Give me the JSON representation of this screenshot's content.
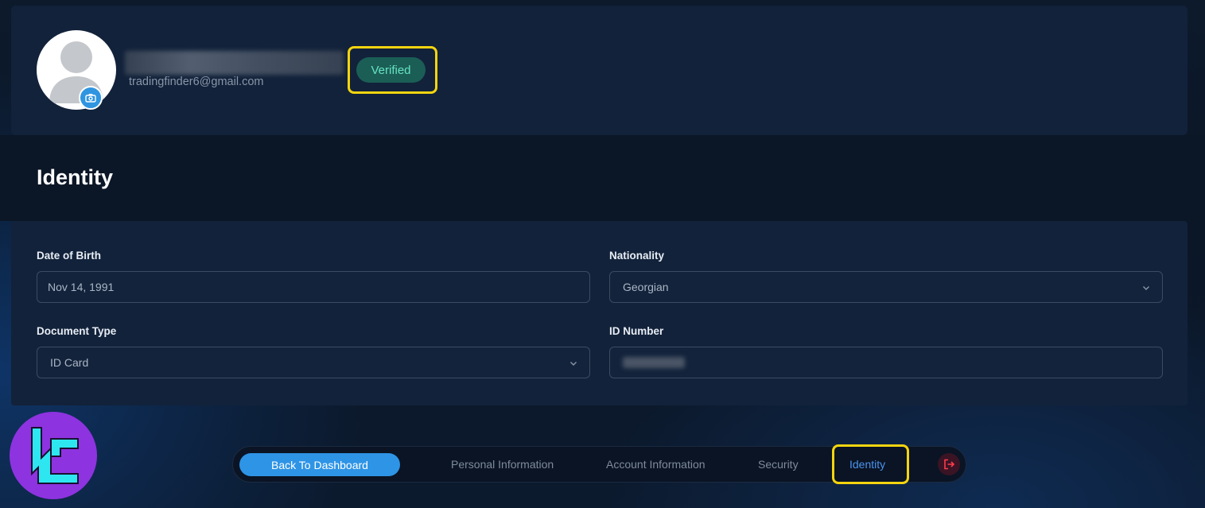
{
  "profile": {
    "email": "tradingfinder6@gmail.com",
    "status_badge": "Verified"
  },
  "section": {
    "title": "Identity"
  },
  "form": {
    "date_of_birth": {
      "label": "Date of Birth",
      "value": "Nov 14, 1991"
    },
    "nationality": {
      "label": "Nationality",
      "value": "Georgian"
    },
    "document_type": {
      "label": "Document Type",
      "value": "ID Card"
    },
    "id_number": {
      "label": "ID Number",
      "value": ""
    }
  },
  "nav": {
    "back_to_dashboard": "Back To Dashboard",
    "personal_information": "Personal Information",
    "account_information": "Account Information",
    "security": "Security",
    "identity": "Identity",
    "logout_icon": "logout-icon"
  },
  "colors": {
    "accent_blue": "#2e94e6",
    "verified_bg": "#1b5e56",
    "verified_text": "#66e3c0",
    "highlight": "#f4d50f",
    "logo_purple": "#8e33e0",
    "logo_cyan": "#2ee6f0"
  }
}
